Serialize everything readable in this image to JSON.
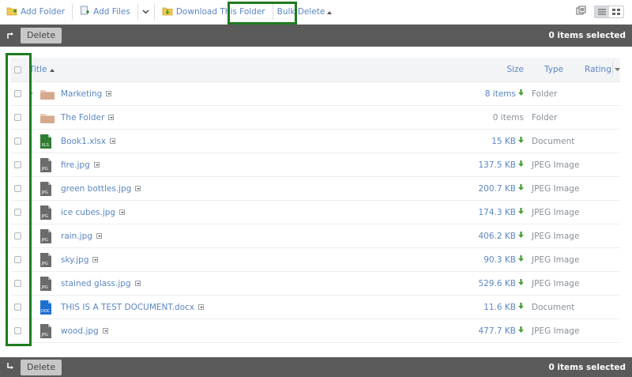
{
  "toolbar": {
    "add_folder": "Add Folder",
    "add_files": "Add Files",
    "download_folder": "Download This Folder",
    "bulk_delete": "Bulk Delete"
  },
  "action_bar": {
    "delete_label": "Delete",
    "selected_text": "0 items selected"
  },
  "grid": {
    "columns": {
      "title": "Title",
      "size": "Size",
      "type": "Type",
      "rating": "Rating"
    },
    "rows": [
      {
        "name": "Marketing",
        "size": "8 items",
        "type": "Folder",
        "icon": "folder-icon"
      },
      {
        "name": "The Folder",
        "size": "0 items",
        "type": "Folder",
        "icon": "folder-icon"
      },
      {
        "name": "Book1.xlsx",
        "size": "15 KB",
        "type": "Document",
        "icon": "excel-file-icon"
      },
      {
        "name": "fire.jpg",
        "size": "137.5 KB",
        "type": "JPEG Image",
        "icon": "jpg-file-icon"
      },
      {
        "name": "green bottles.jpg",
        "size": "200.7 KB",
        "type": "JPEG Image",
        "icon": "jpg-file-icon"
      },
      {
        "name": "ice cubes.jpg",
        "size": "174.3 KB",
        "type": "JPEG Image",
        "icon": "jpg-file-icon"
      },
      {
        "name": "rain.jpg",
        "size": "406.2 KB",
        "type": "JPEG Image",
        "icon": "jpg-file-icon"
      },
      {
        "name": "sky.jpg",
        "size": "90.3 KB",
        "type": "JPEG Image",
        "icon": "jpg-file-icon"
      },
      {
        "name": "stained glass.jpg",
        "size": "529.6 KB",
        "type": "JPEG Image",
        "icon": "jpg-file-icon"
      },
      {
        "name": "THIS IS A TEST DOCUMENT.docx",
        "size": "11.6 KB",
        "type": "Document",
        "icon": "word-file-icon"
      },
      {
        "name": "wood.jpg",
        "size": "477.7 KB",
        "type": "JPEG Image",
        "icon": "jpg-file-icon"
      }
    ]
  },
  "colors": {
    "accent": "#5b86c2",
    "highlight_border": "#1f7a1f",
    "action_bar": "#5a5a5a",
    "download_arrow": "#4aa13a"
  }
}
